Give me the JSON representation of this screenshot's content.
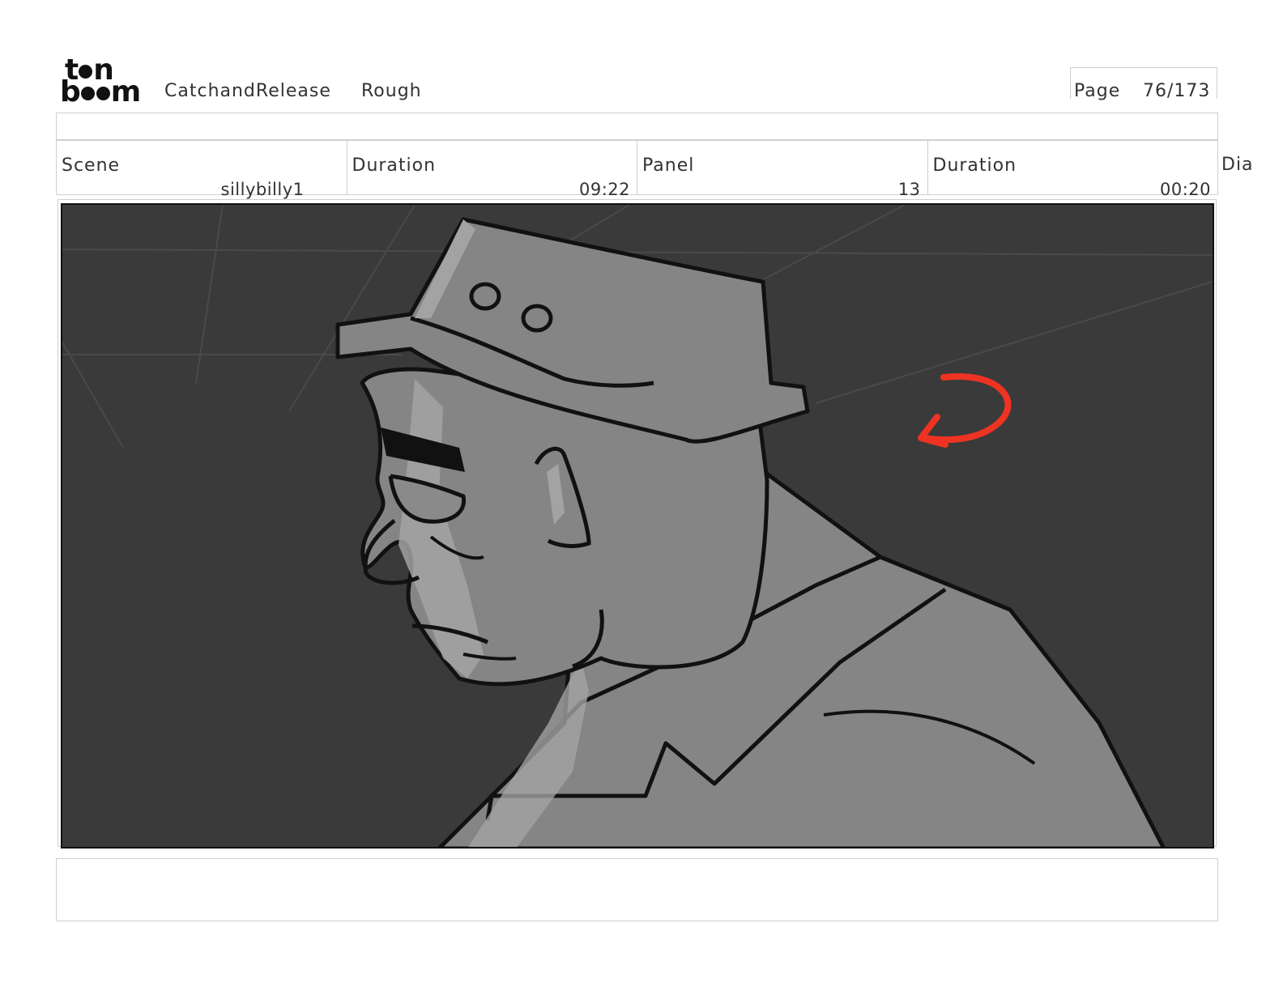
{
  "header": {
    "logo_top": "t",
    "logo_top_end": "n",
    "logo_bottom": "b",
    "logo_bottom_end": "m",
    "project": "CatchandRelease",
    "stage": "Rough",
    "page_label": "Page",
    "page_number": "76/173"
  },
  "info": {
    "scene_label": "Scene",
    "scene_value": "sillybilly1",
    "scene_duration_label": "Duration",
    "scene_duration_value": "09:22",
    "panel_label": "Panel",
    "panel_value": "13",
    "panel_duration_label": "Duration",
    "panel_duration_value": "00:20",
    "dialog_label": "Dia"
  },
  "colors": {
    "background": "#3a3a3a",
    "figure_fill": "#858585",
    "highlight": "#a3a3a3",
    "line": "#111111",
    "annotation_arrow": "#ee3322"
  },
  "icons": {
    "logo": "toonboom-logo",
    "annotation": "curved-arrow-icon"
  }
}
